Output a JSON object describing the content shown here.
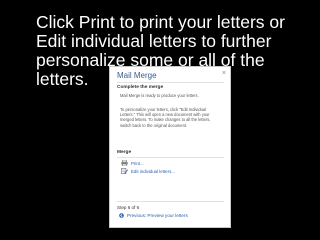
{
  "slide": {
    "caption": "Click Print to print your letters or Edit individual letters to further personalize some or all of the letters."
  },
  "panel": {
    "title": "Mail Merge",
    "close_glyph": "×",
    "complete_heading": "Complete the merge",
    "complete_text": "Mail Merge is ready to produce your letters.",
    "personalize_text": "To personalize your letters, click \"Edit Individual Letters.\" This will open a new document with your merged letters. To make changes to all the letters, switch back to the original document.",
    "merge_heading": "Merge",
    "print_link": "Print...",
    "edit_link": "Edit individual letters...",
    "step_label": "Step 6 of 6",
    "previous_link": "Previous: Preview your letters",
    "icons": {
      "close": "close-icon",
      "print": "printer-icon",
      "edit": "edit-letters-icon",
      "previous": "back-arrow-icon"
    }
  },
  "colors": {
    "background": "#000000",
    "caption_text": "#ffffff",
    "panel_background": "#ffffff",
    "panel_title": "#3c5a8c",
    "link": "#2a5da8"
  }
}
